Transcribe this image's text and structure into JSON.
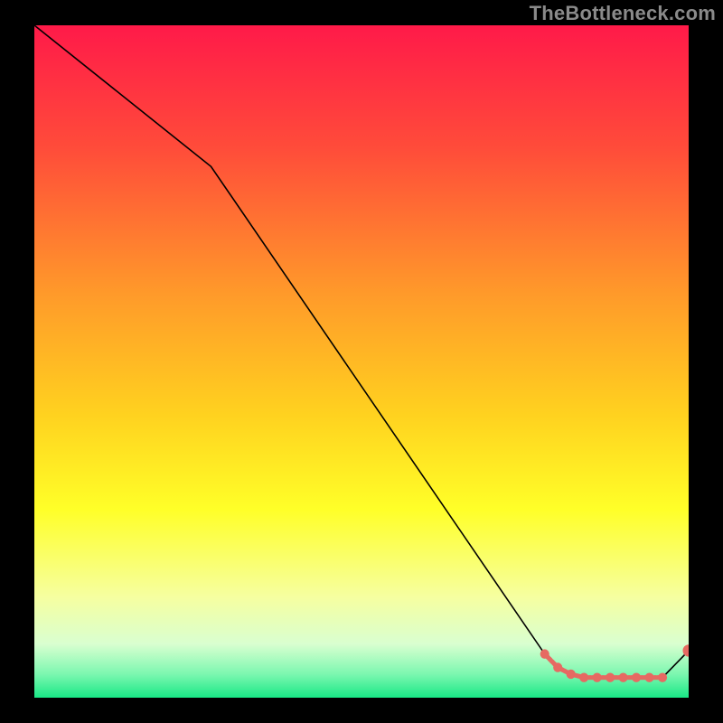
{
  "watermark": "TheBottleneck.com",
  "gradient_stops": [
    {
      "offset": 0.0,
      "color": "#ff1a49"
    },
    {
      "offset": 0.18,
      "color": "#ff4b3a"
    },
    {
      "offset": 0.4,
      "color": "#ff9a2a"
    },
    {
      "offset": 0.58,
      "color": "#ffd21f"
    },
    {
      "offset": 0.72,
      "color": "#ffff28"
    },
    {
      "offset": 0.85,
      "color": "#f6ffa0"
    },
    {
      "offset": 0.92,
      "color": "#d9ffd0"
    },
    {
      "offset": 0.965,
      "color": "#7cf7b0"
    },
    {
      "offset": 1.0,
      "color": "#19e886"
    }
  ],
  "marker_color": "#e66a62",
  "chart_data": {
    "type": "line",
    "title": "",
    "xlabel": "",
    "ylabel": "",
    "xlim": [
      0,
      100
    ],
    "ylim": [
      0,
      100
    ],
    "grid": false,
    "legend": false,
    "series": [
      {
        "name": "curve",
        "x": [
          0,
          27,
          78,
          80,
          82,
          84,
          86,
          88,
          90,
          92,
          94,
          96,
          100
        ],
        "y": [
          100,
          79,
          6.5,
          4.5,
          3.5,
          3,
          3,
          3,
          3,
          3,
          3,
          3,
          7
        ]
      }
    ],
    "highlight": {
      "name": "optimal-region",
      "x": [
        78,
        80,
        82,
        84,
        86,
        88,
        90,
        92,
        94,
        96,
        100
      ],
      "y": [
        6.5,
        4.5,
        3.5,
        3,
        3,
        3,
        3,
        3,
        3,
        3,
        7
      ]
    }
  }
}
